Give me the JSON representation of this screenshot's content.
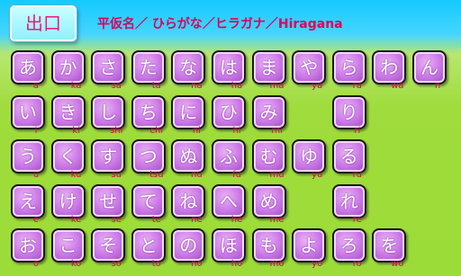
{
  "header": {
    "exit_label": "出口",
    "title": "平仮名／ ひらがな／ヒラガナ／Hiragana"
  },
  "keys": [
    {
      "kana": "あ",
      "romaji": "a",
      "row": 0,
      "col": 0
    },
    {
      "kana": "か",
      "romaji": "ka",
      "row": 0,
      "col": 1
    },
    {
      "kana": "さ",
      "romaji": "sa",
      "row": 0,
      "col": 2
    },
    {
      "kana": "た",
      "romaji": "ta",
      "row": 0,
      "col": 3
    },
    {
      "kana": "な",
      "romaji": "na",
      "row": 0,
      "col": 4
    },
    {
      "kana": "は",
      "romaji": "ha",
      "row": 0,
      "col": 5
    },
    {
      "kana": "ま",
      "romaji": "ma",
      "row": 0,
      "col": 6
    },
    {
      "kana": "や",
      "romaji": "ya",
      "row": 0,
      "col": 7
    },
    {
      "kana": "ら",
      "romaji": "ra",
      "row": 0,
      "col": 8
    },
    {
      "kana": "わ",
      "romaji": "wa",
      "row": 0,
      "col": 9
    },
    {
      "kana": "ん",
      "romaji": "n",
      "row": 0,
      "col": 10
    },
    {
      "kana": "い",
      "romaji": "i",
      "row": 1,
      "col": 0
    },
    {
      "kana": "き",
      "romaji": "ki",
      "row": 1,
      "col": 1
    },
    {
      "kana": "し",
      "romaji": "shi",
      "row": 1,
      "col": 2
    },
    {
      "kana": "ち",
      "romaji": "chi",
      "row": 1,
      "col": 3
    },
    {
      "kana": "に",
      "romaji": "ni",
      "row": 1,
      "col": 4
    },
    {
      "kana": "ひ",
      "romaji": "hi",
      "row": 1,
      "col": 5
    },
    {
      "kana": "み",
      "romaji": "mi",
      "row": 1,
      "col": 6
    },
    {
      "kana": "り",
      "romaji": "ri",
      "row": 1,
      "col": 8
    },
    {
      "kana": "う",
      "romaji": "u",
      "row": 2,
      "col": 0
    },
    {
      "kana": "く",
      "romaji": "ku",
      "row": 2,
      "col": 1
    },
    {
      "kana": "す",
      "romaji": "su",
      "row": 2,
      "col": 2
    },
    {
      "kana": "つ",
      "romaji": "tsu",
      "row": 2,
      "col": 3
    },
    {
      "kana": "ぬ",
      "romaji": "nu",
      "row": 2,
      "col": 4
    },
    {
      "kana": "ふ",
      "romaji": "fu",
      "row": 2,
      "col": 5
    },
    {
      "kana": "む",
      "romaji": "mu",
      "row": 2,
      "col": 6
    },
    {
      "kana": "ゆ",
      "romaji": "yu",
      "row": 2,
      "col": 7
    },
    {
      "kana": "る",
      "romaji": "ru",
      "row": 2,
      "col": 8
    },
    {
      "kana": "え",
      "romaji": "e",
      "row": 3,
      "col": 0
    },
    {
      "kana": "け",
      "romaji": "ke",
      "row": 3,
      "col": 1
    },
    {
      "kana": "せ",
      "romaji": "se",
      "row": 3,
      "col": 2
    },
    {
      "kana": "て",
      "romaji": "te",
      "row": 3,
      "col": 3
    },
    {
      "kana": "ね",
      "romaji": "ne",
      "row": 3,
      "col": 4
    },
    {
      "kana": "へ",
      "romaji": "he",
      "row": 3,
      "col": 5
    },
    {
      "kana": "め",
      "romaji": "me",
      "row": 3,
      "col": 6
    },
    {
      "kana": "れ",
      "romaji": "re",
      "row": 3,
      "col": 8
    },
    {
      "kana": "お",
      "romaji": "o",
      "row": 4,
      "col": 0
    },
    {
      "kana": "こ",
      "romaji": "ko",
      "row": 4,
      "col": 1
    },
    {
      "kana": "そ",
      "romaji": "so",
      "row": 4,
      "col": 2
    },
    {
      "kana": "と",
      "romaji": "to",
      "row": 4,
      "col": 3
    },
    {
      "kana": "の",
      "romaji": "no",
      "row": 4,
      "col": 4
    },
    {
      "kana": "ほ",
      "romaji": "ho",
      "row": 4,
      "col": 5
    },
    {
      "kana": "も",
      "romaji": "mo",
      "row": 4,
      "col": 6
    },
    {
      "kana": "よ",
      "romaji": "yo",
      "row": 4,
      "col": 7
    },
    {
      "kana": "ろ",
      "romaji": "ro",
      "row": 4,
      "col": 8
    },
    {
      "kana": "を",
      "romaji": "wo",
      "row": 4,
      "col": 9
    }
  ],
  "colors": {
    "header_bg": "#16c9ff",
    "title_text": "#e0005a",
    "key_fill": "#d080ea",
    "romaji_text": "#e0005a",
    "background": "#9cdc38"
  }
}
